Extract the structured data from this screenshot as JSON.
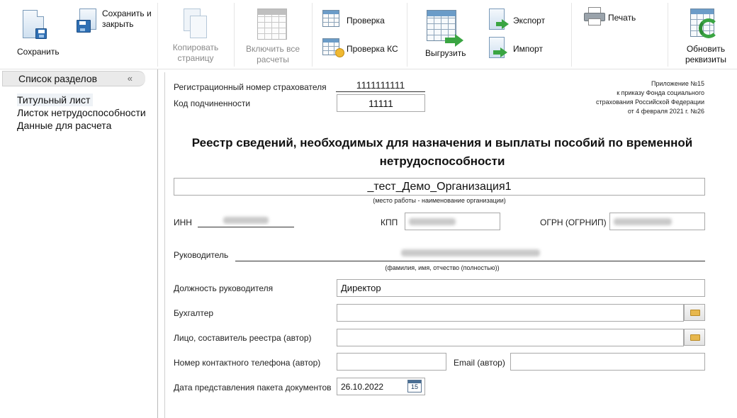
{
  "toolbar": {
    "save": "Сохранить",
    "save_close_1": "Сохранить и",
    "save_close_2": "закрыть",
    "copy_1": "Копировать",
    "copy_2": "страницу",
    "include_1": "Включить все",
    "include_2": "расчеты",
    "check": "Проверка",
    "check_ks": "Проверка КС",
    "upload": "Выгрузить",
    "export": "Экспорт",
    "import": "Импорт",
    "print": "Печать",
    "refresh_1": "Обновить",
    "refresh_2": "реквизиты"
  },
  "sidebar": {
    "header": "Список разделов",
    "collapse": "«",
    "items": [
      "Титульный лист",
      "Листок нетрудоспособности",
      "Данные для расчета"
    ]
  },
  "form": {
    "reg_label": "Регистрационный номер страхователя",
    "reg_value": "1111111111",
    "sub_label": "Код подчиненности",
    "sub_value": "11111",
    "notice_1": "Приложение №15",
    "notice_2": "к приказу Фонда социального",
    "notice_3": "страхования Российской Федерации",
    "notice_4": "от 4 февраля 2021 г. №26",
    "title_1": "Реестр сведений, необходимых для назначения и выплаты пособий по временной",
    "title_2": "нетрудоспособности",
    "org_value": "_тест_Демо_Организация1",
    "org_hint": "(место работы - наименование организации)",
    "inn_label": "ИНН",
    "kpp_label": "КПП",
    "ogrn_label": "ОГРН (ОГРНИП)",
    "head_label": "Руководитель",
    "head_hint": "(фамилия, имя, отчество (полностью))",
    "position_label": "Должность руководителя",
    "position_value": "Директор",
    "accountant_label": "Бухгалтер",
    "author_label": "Лицо, составитель реестра (автор)",
    "phone_label": "Номер контактного телефона (автор)",
    "email_label": "Email (автор)",
    "date_label": "Дата представления пакета документов",
    "date_value": "26.10.2022",
    "cal_day": "15"
  }
}
